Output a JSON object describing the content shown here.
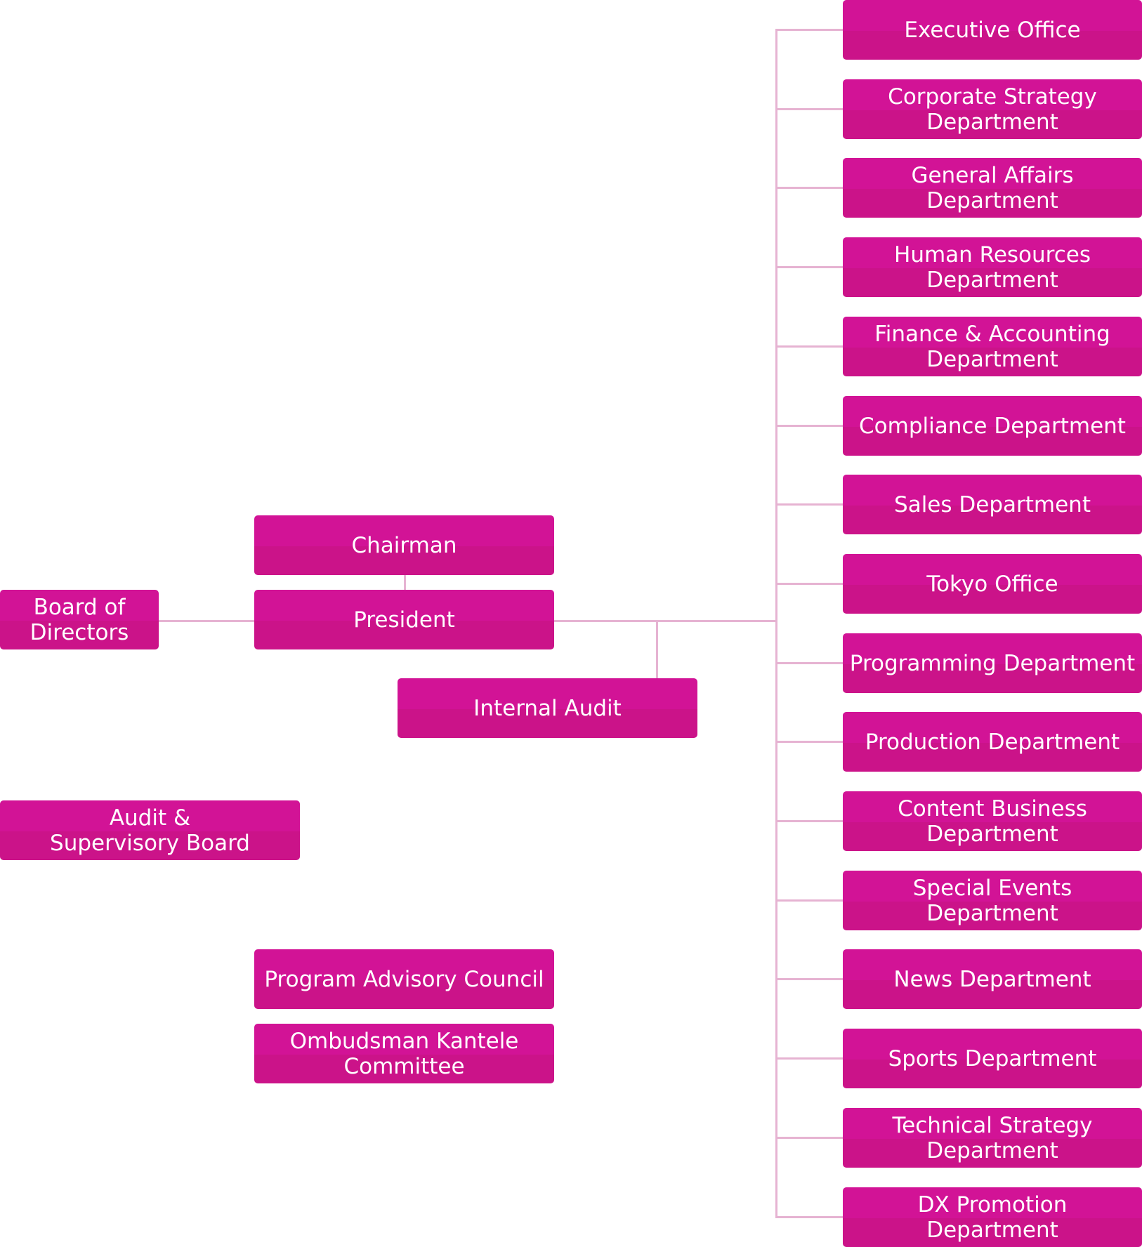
{
  "colors": {
    "box": "#d21396",
    "box_lower": "#cb1389",
    "connector": "#e6b3d2",
    "text": "#ffffff"
  },
  "board_of_directors": "Board of\nDirectors",
  "chairman": "Chairman",
  "president": "President",
  "internal_audit": "Internal Audit",
  "audit_supervisory_board": "Audit &\nSupervisory Board",
  "program_advisory_council": "Program Advisory Council",
  "ombudsman": "Ombudsman Kantele\nCommittee",
  "departments": [
    "Executive Office",
    "Corporate Strategy\nDepartment",
    "General Affairs\nDepartment",
    "Human Resources\nDepartment",
    "Finance & Accounting\nDepartment",
    "Compliance Department",
    "Sales Department",
    "Tokyo Office",
    "Programming Department",
    "Production Department",
    "Content Business\nDepartment",
    "Special Events\nDepartment",
    "News Department",
    "Sports Department",
    "Technical Strategy\nDepartment",
    "DX Promotion\nDepartment"
  ]
}
